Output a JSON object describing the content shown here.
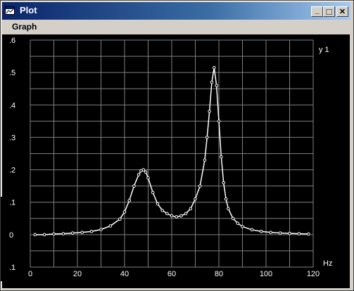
{
  "window": {
    "title": "Plot",
    "minimize_glyph": "_",
    "maximize_glyph": "□",
    "close_glyph": "✕"
  },
  "menu": {
    "items": [
      "Graph"
    ]
  },
  "chart_data": {
    "type": "line",
    "title": "",
    "xlabel": "Hz",
    "ylabel": "y 1",
    "xlim": [
      0,
      120
    ],
    "ylim": [
      -0.1,
      0.6
    ],
    "x_ticks": [
      0,
      20,
      40,
      60,
      80,
      100,
      120
    ],
    "x_tick_labels": [
      "0",
      "20",
      "40",
      "60",
      "80",
      "100",
      "120"
    ],
    "y_ticks": [
      -0.1,
      0,
      0.1,
      0.2,
      0.3,
      0.4,
      0.5,
      0.6
    ],
    "y_tick_labels": [
      ".1",
      "0",
      ".1",
      ".2",
      ".3",
      ".4",
      ".5",
      ".6"
    ],
    "grid": true,
    "background": "#000000",
    "grid_color": "#808080",
    "line_color": "#ffffff",
    "series": [
      {
        "x": [
          2,
          6,
          10,
          14,
          18,
          22,
          26,
          30,
          34,
          38,
          40,
          42,
          44,
          46,
          47,
          48,
          49,
          50,
          52,
          54,
          56,
          58,
          60,
          62,
          64,
          66,
          68,
          70,
          72,
          74,
          75,
          76,
          77,
          78,
          79,
          80,
          81,
          82,
          83,
          84,
          86,
          88,
          90,
          94,
          98,
          102,
          106,
          110,
          114,
          118
        ],
        "y": [
          0.0,
          0.0,
          0.002,
          0.003,
          0.005,
          0.007,
          0.01,
          0.016,
          0.027,
          0.048,
          0.07,
          0.105,
          0.15,
          0.185,
          0.197,
          0.2,
          0.193,
          0.175,
          0.13,
          0.095,
          0.075,
          0.065,
          0.058,
          0.055,
          0.058,
          0.065,
          0.08,
          0.11,
          0.15,
          0.23,
          0.3,
          0.38,
          0.47,
          0.515,
          0.46,
          0.35,
          0.24,
          0.16,
          0.11,
          0.08,
          0.05,
          0.035,
          0.025,
          0.015,
          0.01,
          0.007,
          0.005,
          0.004,
          0.003,
          0.002
        ]
      }
    ]
  }
}
